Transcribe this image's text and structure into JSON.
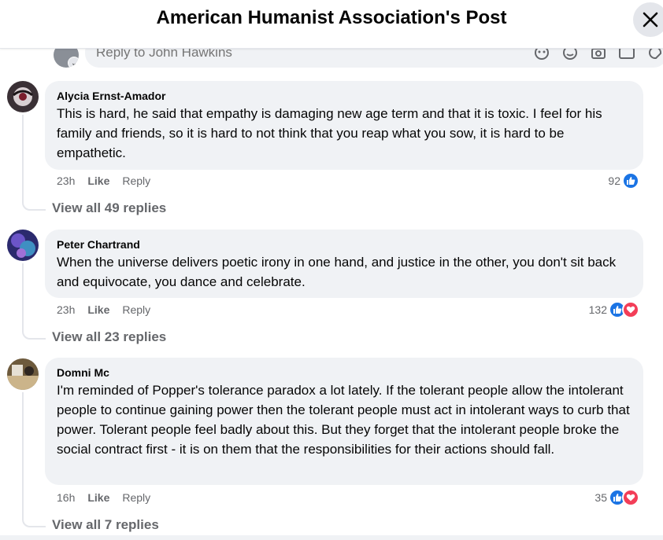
{
  "header": {
    "title": "American Humanist Association's Post"
  },
  "reply_bar": {
    "placeholder": "Reply to John Hawkins"
  },
  "comments": [
    {
      "author": "Alycia Ernst-Amador",
      "text": "This is hard, he said that empathy is damaging new age term and that it is toxic. I feel for his family and friends, so it is hard to not think that you reap what you sow, it is hard to be empathetic.",
      "time": "23h",
      "like_label": "Like",
      "reply_label": "Reply",
      "reaction_count": "92",
      "reactions": [
        "like"
      ],
      "view_replies": "View all 49 replies"
    },
    {
      "author": "Peter Chartrand",
      "text": "When the universe delivers poetic irony in one hand, and justice in the other, you don't sit back and equivocate, you dance and celebrate.",
      "time": "23h",
      "like_label": "Like",
      "reply_label": "Reply",
      "reaction_count": "132",
      "reactions": [
        "like",
        "love"
      ],
      "view_replies": "View all 23 replies"
    },
    {
      "author": "Domni Mc",
      "text": "I'm reminded of Popper's tolerance paradox a lot lately. If the tolerant people allow the intolerant people to continue gaining power then the tolerant people must act in intolerant ways to curb that power. Tolerant people feel badly about this. But they forget that the intolerant people broke the social contract first - it is on them that the responsibilities for their actions should fall.",
      "time": "16h",
      "like_label": "Like",
      "reply_label": "Reply",
      "reaction_count": "35",
      "reactions": [
        "like",
        "love"
      ],
      "view_replies": "View all 7 replies"
    }
  ],
  "colors": {
    "like_blue": "#1b74e4",
    "love_red": "#f33e58",
    "bubble_bg": "#f0f2f5",
    "meta_gray": "#65676b"
  }
}
